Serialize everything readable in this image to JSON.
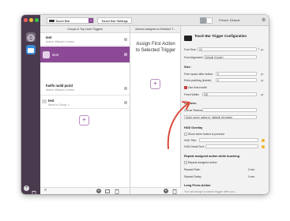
{
  "toolbar": {
    "device_select": "Touch Bar",
    "settings_button": "Touch Bar Settings",
    "preset_label": "Preset: Default"
  },
  "groups": {
    "header": "Groups & Top Level Triggers",
    "rows": [
      {
        "title": "test",
        "subtitle": "Action: Mission Control"
      },
      {
        "title": "dent",
        "subtitle": ""
      },
      {
        "title": "fuelfs nuild puird",
        "subtitle": "Action: Mission Control"
      },
      {
        "title": "test",
        "subtitle": "Items in Group: 1"
      }
    ],
    "add_label": "+"
  },
  "assigned": {
    "header": "Actions Assigned to Selected T...",
    "message": "Assign First Action to Selected Trigger",
    "add_label": "+"
  },
  "config": {
    "title": "Touch Bar Trigger Configuration",
    "font_size_label": "Font Size:",
    "font_size": "15",
    "font_alignment_label": "Font Alignment:",
    "font_alignment": "Default (Center)",
    "size_heading": "Size:",
    "free_space_label": "Free space after button:",
    "free_space": "0",
    "extra_padding_label": "Extra padding (inside):",
    "extra_padding": "0",
    "unit": "px",
    "fixed_width_check": "Use fixed width",
    "fixed_width_label": "Fixed Width:",
    "fixed_width": "200",
    "corners_heading": "Corners:",
    "corner_radius_label": "Corner Radius:",
    "corner_apply": "Apply corner radius to: (default: all edges)",
    "hud_heading": "HUD Overlay",
    "hud_check": "Show when button is pressed",
    "hud_title_label": "HUD Title:",
    "hud_detail_label": "HUD Detail Text:",
    "repeat_heading": "Repeat assigned action while touching",
    "repeat_check": "Repeat assigned action",
    "repeat_rate_label": "Repeat Rate:",
    "repeat_rate": "0 sec",
    "repeat_delay_label": "Repeat Delay:",
    "repeat_delay": "0 sec",
    "long_press_heading": "Long Press Action",
    "long_press_text": "You can assign a named trigger after you..."
  },
  "colors": {
    "sidebar": "#4a3a4d",
    "selected_row": "#8c4a96",
    "arrow": "#d94a3a"
  }
}
